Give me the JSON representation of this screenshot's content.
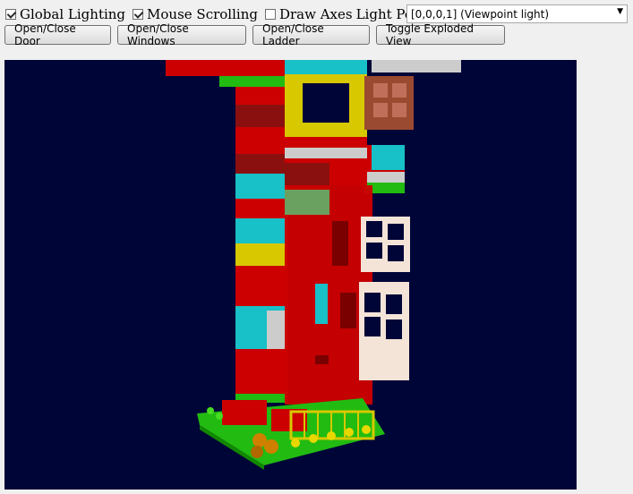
{
  "toolbar": {
    "global_lighting": {
      "label": "Global Lighting",
      "checked": true
    },
    "mouse_scrolling": {
      "label": "Mouse Scrolling",
      "checked": true
    },
    "draw_axes": {
      "label": "Draw Axes",
      "checked": false
    },
    "light_position_label": "Light Position:",
    "light_position_value": "[0,0,0,1] (Viewpoint light)"
  },
  "buttons": {
    "door": "Open/Close Door",
    "windows": "Open/Close Windows",
    "ladder": "Open/Close Ladder",
    "exploded": "Toggle Exploded View"
  },
  "viewport": {
    "background": "#000538",
    "colors": {
      "red": "#cc0000",
      "dark_red": "#8a1010",
      "cyan": "#18c0c8",
      "green": "#22bb11",
      "yellow": "#d8c800",
      "white": "#f4e4d8",
      "gray": "#cccccc",
      "brown": "#9a4a30",
      "orange": "#d08000"
    }
  }
}
